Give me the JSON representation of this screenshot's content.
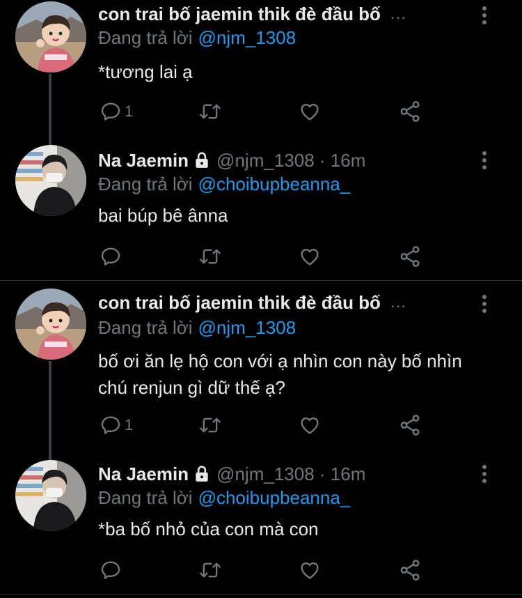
{
  "tweets": [
    {
      "author": "con trai bố jaemin thik đè đầu bố",
      "author_truncated": true,
      "handle_meta": "",
      "locked": false,
      "reply_prefix": "Đang trả lời",
      "reply_to": "@njm_1308",
      "text": "*tương lai ạ",
      "reply_count": "1",
      "avatar": "child-photo",
      "thread_continues": true
    },
    {
      "author": "Na Jaemin",
      "author_truncated": false,
      "handle_meta": "@njm_1308 · 16m",
      "locked": true,
      "reply_prefix": "Đang trả lời",
      "reply_to": "@choibupbeanna_",
      "text": "bai búp bê ânna",
      "reply_count": "",
      "avatar": "masked-person-photo",
      "thread_continues": false
    },
    {
      "author": "con trai bố jaemin thik đè đầu bố",
      "author_truncated": true,
      "handle_meta": "",
      "locked": false,
      "reply_prefix": "Đang trả lời",
      "reply_to": "@njm_1308",
      "text": "bố ơi ăn lẹ hộ con với ạ nhìn con này bố nhìn chú renjun gì dữ thế ạ?",
      "reply_count": "1",
      "avatar": "child-photo",
      "thread_continues": true
    },
    {
      "author": "Na Jaemin",
      "author_truncated": false,
      "handle_meta": "@njm_1308 · 16m",
      "locked": true,
      "reply_prefix": "Đang trả lời",
      "reply_to": "@choibupbeanna_",
      "text": "*ba bố nhỏ của con mà con",
      "reply_count": "",
      "avatar": "masked-person-photo",
      "thread_continues": false
    }
  ],
  "ellipsis": "...",
  "colors": {
    "background": "#000000",
    "primary_text": "#e7e9ea",
    "secondary_text": "#71767b",
    "link": "#1d9bf0",
    "divider": "#2f3336"
  },
  "icons": [
    "reply-icon",
    "retweet-icon",
    "like-icon",
    "share-icon",
    "more-options-icon",
    "lock-icon"
  ]
}
